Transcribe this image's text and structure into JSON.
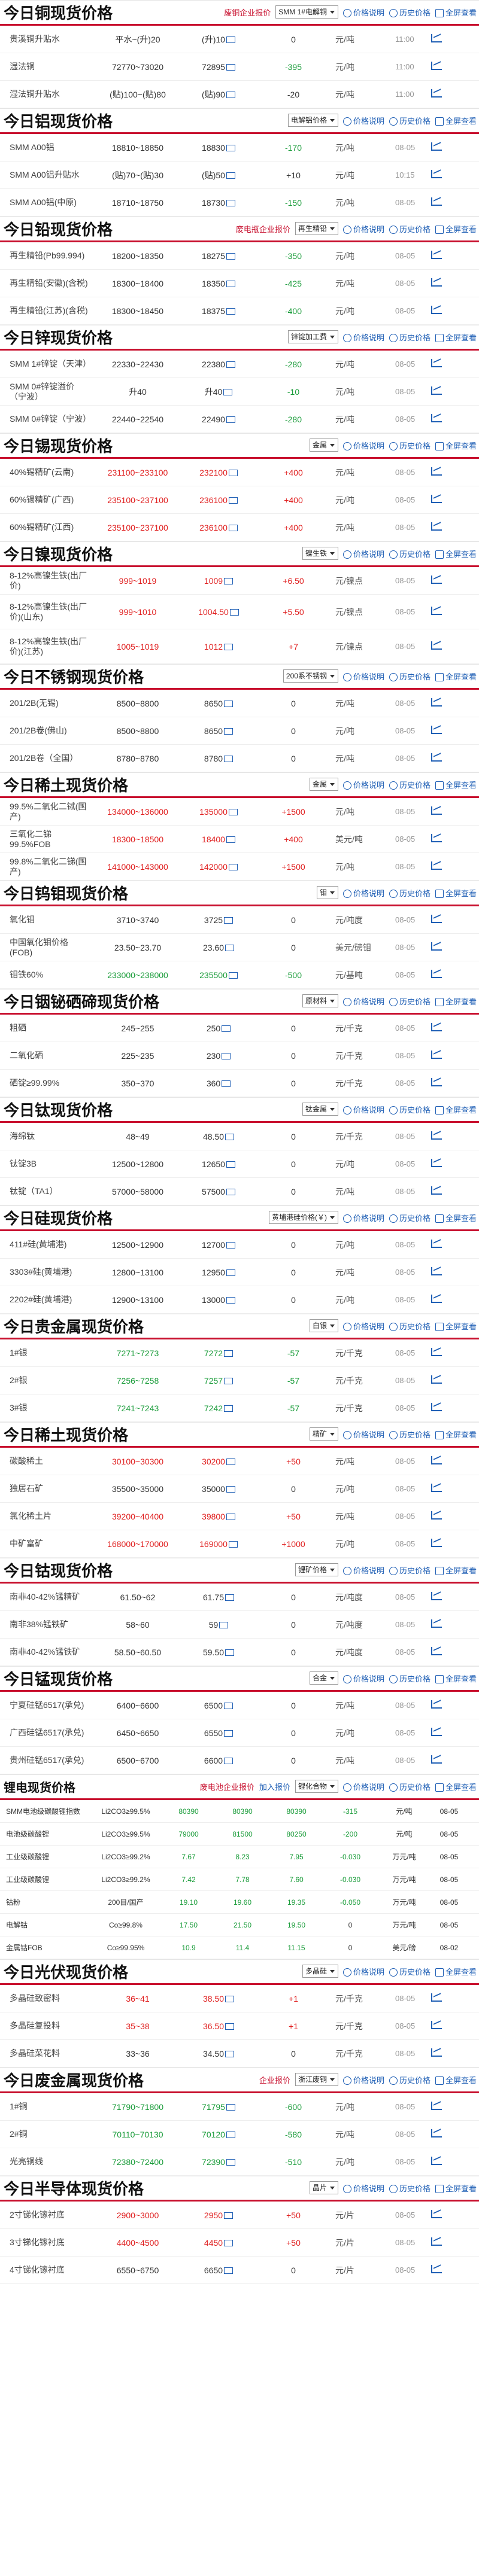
{
  "labels": {
    "join_price": "加入报价",
    "price_desc": "价格说明",
    "history": "历史价格",
    "all": "全屏查看"
  },
  "sections": [
    {
      "title": "今日铜现货价格",
      "tag": "废铜企业报价",
      "select": "SMM 1#电解铜",
      "rows": [
        {
          "name": "贵溪铜升贴水",
          "range": "平水~(升)20",
          "avg": "(升)10",
          "chg": "0",
          "unit": "元/吨",
          "date": "11:00",
          "chg_color": "black"
        },
        {
          "name": "湿法铜",
          "range": "72770~73020",
          "avg": "72895",
          "chg": "-395",
          "unit": "元/吨",
          "date": "11:00",
          "chg_color": "green"
        },
        {
          "name": "湿法铜升贴水",
          "range": "(贴)100~(贴)80",
          "avg": "(贴)90",
          "chg": "-20",
          "unit": "元/吨",
          "date": "11:00",
          "chg_color": "black"
        }
      ]
    },
    {
      "title": "今日铝现货价格",
      "select": "电解铝价格",
      "rows": [
        {
          "name": "SMM A00铝",
          "range": "18810~18850",
          "avg": "18830",
          "chg": "-170",
          "unit": "元/吨",
          "date": "08-05",
          "chg_color": "green"
        },
        {
          "name": "SMM A00铝升贴水",
          "range": "(贴)70~(贴)30",
          "avg": "(贴)50",
          "chg": "+10",
          "unit": "元/吨",
          "date": "10:15",
          "chg_color": "black"
        },
        {
          "name": "SMM A00铝(中原)",
          "range": "18710~18750",
          "avg": "18730",
          "chg": "-150",
          "unit": "元/吨",
          "date": "08-05",
          "chg_color": "green"
        }
      ]
    },
    {
      "title": "今日铅现货价格",
      "tag": "废电瓶企业报价",
      "select": "再生精铅",
      "rows": [
        {
          "name": "再生精铅(Pb99.994)",
          "range": "18200~18350",
          "avg": "18275",
          "chg": "-350",
          "unit": "元/吨",
          "date": "08-05",
          "chg_color": "green"
        },
        {
          "name": "再生精铅(安徽)(含税)",
          "range": "18300~18400",
          "avg": "18350",
          "chg": "-425",
          "unit": "元/吨",
          "date": "08-05",
          "chg_color": "green"
        },
        {
          "name": "再生精铅(江苏)(含税)",
          "range": "18300~18450",
          "avg": "18375",
          "chg": "-400",
          "unit": "元/吨",
          "date": "08-05",
          "chg_color": "green"
        }
      ]
    },
    {
      "title": "今日锌现货价格",
      "select": "锌锭加工费",
      "rows": [
        {
          "name": "SMM 1#锌锭（天津）",
          "range": "22330~22430",
          "avg": "22380",
          "chg": "-280",
          "unit": "元/吨",
          "date": "08-05",
          "chg_color": "green"
        },
        {
          "name": "SMM 0#锌锭溢价（宁波）",
          "range": "升40",
          "avg": "升40",
          "chg": "-10",
          "unit": "元/吨",
          "date": "08-05",
          "chg_color": "green"
        },
        {
          "name": "SMM 0#锌锭（宁波）",
          "range": "22440~22540",
          "avg": "22490",
          "chg": "-280",
          "unit": "元/吨",
          "date": "08-05",
          "chg_color": "green"
        }
      ]
    },
    {
      "title": "今日锡现货价格",
      "select": "金属",
      "rows": [
        {
          "name": "40%锡精矿(云南)",
          "range": "231100~233100",
          "avg": "232100",
          "chg": "+400",
          "unit": "元/吨",
          "date": "08-05",
          "chg_color": "red",
          "rc": "red"
        },
        {
          "name": "60%锡精矿(广西)",
          "range": "235100~237100",
          "avg": "236100",
          "chg": "+400",
          "unit": "元/吨",
          "date": "08-05",
          "chg_color": "red",
          "rc": "red"
        },
        {
          "name": "60%锡精矿(江西)",
          "range": "235100~237100",
          "avg": "236100",
          "chg": "+400",
          "unit": "元/吨",
          "date": "08-05",
          "chg_color": "red",
          "rc": "red"
        }
      ]
    },
    {
      "title": "今日镍现货价格",
      "select": "镍生铁",
      "rows": [
        {
          "name": "8-12%高镍生铁(出厂价)",
          "range": "999~1019",
          "avg": "1009",
          "chg": "+6.50",
          "unit": "元/镍点",
          "date": "08-05",
          "chg_color": "red",
          "rc": "red"
        },
        {
          "name": "8-12%高镍生铁(出厂价)(山东)",
          "range": "999~1010",
          "avg": "1004.50",
          "chg": "+5.50",
          "unit": "元/镍点",
          "date": "08-05",
          "chg_color": "red",
          "rc": "red"
        },
        {
          "name": "8-12%高镍生铁(出厂价)(江苏)",
          "range": "1005~1019",
          "avg": "1012",
          "chg": "+7",
          "unit": "元/镍点",
          "date": "08-05",
          "chg_color": "red",
          "rc": "red"
        }
      ]
    },
    {
      "title": "今日不锈钢现货价格",
      "select": "200系不锈钢",
      "rows": [
        {
          "name": "201/2B(无锡)",
          "range": "8500~8800",
          "avg": "8650",
          "chg": "0",
          "unit": "元/吨",
          "date": "08-05",
          "chg_color": "black"
        },
        {
          "name": "201/2B卷(佛山)",
          "range": "8500~8800",
          "avg": "8650",
          "chg": "0",
          "unit": "元/吨",
          "date": "08-05",
          "chg_color": "black"
        },
        {
          "name": "201/2B卷（全国）",
          "range": "8780~8780",
          "avg": "8780",
          "chg": "0",
          "unit": "元/吨",
          "date": "08-05",
          "chg_color": "black"
        }
      ]
    },
    {
      "title": "今日稀土现货价格",
      "select": "金属",
      "rows": [
        {
          "name": "99.5%二氧化二铽(国产)",
          "range": "134000~136000",
          "avg": "135000",
          "chg": "+1500",
          "unit": "元/吨",
          "date": "08-05",
          "chg_color": "red",
          "rc": "red"
        },
        {
          "name": "三氧化二锑99.5%FOB",
          "range": "18300~18500",
          "avg": "18400",
          "chg": "+400",
          "unit": "美元/吨",
          "date": "08-05",
          "chg_color": "red",
          "rc": "red"
        },
        {
          "name": "99.8%二氧化二锑(国产)",
          "range": "141000~143000",
          "avg": "142000",
          "chg": "+1500",
          "unit": "元/吨",
          "date": "08-05",
          "chg_color": "red",
          "rc": "red"
        }
      ]
    },
    {
      "title": "今日钨钼现货价格",
      "select": "钼",
      "rows": [
        {
          "name": "氧化钼",
          "range": "3710~3740",
          "avg": "3725",
          "chg": "0",
          "unit": "元/吨度",
          "date": "08-05",
          "chg_color": "black"
        },
        {
          "name": "中国氧化钼价格(FOB)",
          "range": "23.50~23.70",
          "avg": "23.60",
          "chg": "0",
          "unit": "美元/磅钼",
          "date": "08-05",
          "chg_color": "black"
        },
        {
          "name": "钼铁60%",
          "range": "233000~238000",
          "avg": "235500",
          "chg": "-500",
          "unit": "元/基吨",
          "date": "08-05",
          "chg_color": "green",
          "rc": "green"
        }
      ]
    },
    {
      "title": "今日铟铋硒碲现货价格",
      "select": "原材料",
      "rows": [
        {
          "name": "粗硒",
          "range": "245~255",
          "avg": "250",
          "chg": "0",
          "unit": "元/千克",
          "date": "08-05",
          "chg_color": "black"
        },
        {
          "name": "二氧化硒",
          "range": "225~235",
          "avg": "230",
          "chg": "0",
          "unit": "元/千克",
          "date": "08-05",
          "chg_color": "black"
        },
        {
          "name": "硒锭≥99.99%",
          "range": "350~370",
          "avg": "360",
          "chg": "0",
          "unit": "元/千克",
          "date": "08-05",
          "chg_color": "black"
        }
      ]
    },
    {
      "title": "今日钛现货价格",
      "select": "钛金属",
      "rows": [
        {
          "name": "海绵钛",
          "range": "48~49",
          "avg": "48.50",
          "chg": "0",
          "unit": "元/千克",
          "date": "08-05",
          "chg_color": "black"
        },
        {
          "name": "钛锭3B",
          "range": "12500~12800",
          "avg": "12650",
          "chg": "0",
          "unit": "元/吨",
          "date": "08-05",
          "chg_color": "black"
        },
        {
          "name": "钛锭（TA1）",
          "range": "57000~58000",
          "avg": "57500",
          "chg": "0",
          "unit": "元/吨",
          "date": "08-05",
          "chg_color": "black"
        }
      ]
    },
    {
      "title": "今日硅现货价格",
      "select": "黄埔港硅价格(￥)",
      "rows": [
        {
          "name": "411#硅(黄埔港)",
          "range": "12500~12900",
          "avg": "12700",
          "chg": "0",
          "unit": "元/吨",
          "date": "08-05",
          "chg_color": "black"
        },
        {
          "name": "3303#硅(黄埔港)",
          "range": "12800~13100",
          "avg": "12950",
          "chg": "0",
          "unit": "元/吨",
          "date": "08-05",
          "chg_color": "black"
        },
        {
          "name": "2202#硅(黄埔港)",
          "range": "12900~13100",
          "avg": "13000",
          "chg": "0",
          "unit": "元/吨",
          "date": "08-05",
          "chg_color": "black"
        }
      ]
    },
    {
      "title": "今日贵金属现货价格",
      "select": "白银",
      "rows": [
        {
          "name": "1#银",
          "range": "7271~7273",
          "avg": "7272",
          "chg": "-57",
          "unit": "元/千克",
          "date": "08-05",
          "chg_color": "green",
          "rc": "green"
        },
        {
          "name": "2#银",
          "range": "7256~7258",
          "avg": "7257",
          "chg": "-57",
          "unit": "元/千克",
          "date": "08-05",
          "chg_color": "green",
          "rc": "green"
        },
        {
          "name": "3#银",
          "range": "7241~7243",
          "avg": "7242",
          "chg": "-57",
          "unit": "元/千克",
          "date": "08-05",
          "chg_color": "green",
          "rc": "green"
        }
      ]
    },
    {
      "title": "今日稀土现货价格",
      "select": "精矿",
      "rows": [
        {
          "name": "碳酸稀土",
          "range": "30100~30300",
          "avg": "30200",
          "chg": "+50",
          "unit": "元/吨",
          "date": "08-05",
          "chg_color": "red",
          "rc": "red"
        },
        {
          "name": "独居石矿",
          "range": "35500~35000",
          "avg": "35000",
          "chg": "0",
          "unit": "元/吨",
          "date": "08-05",
          "chg_color": "black"
        },
        {
          "name": "氯化稀土片",
          "range": "39200~40400",
          "avg": "39800",
          "chg": "+50",
          "unit": "元/吨",
          "date": "08-05",
          "chg_color": "red",
          "rc": "red"
        },
        {
          "name": "中矿富矿",
          "range": "168000~170000",
          "avg": "169000",
          "chg": "+1000",
          "unit": "元/吨",
          "date": "08-05",
          "chg_color": "red",
          "rc": "red"
        }
      ]
    },
    {
      "title": "今日钴现货价格",
      "select": "锂矿价格",
      "rows": [
        {
          "name": "南非40-42%锰精矿",
          "range": "61.50~62",
          "avg": "61.75",
          "chg": "0",
          "unit": "元/吨度",
          "date": "08-05",
          "chg_color": "black"
        },
        {
          "name": "南非38%锰铁矿",
          "range": "58~60",
          "avg": "59",
          "chg": "0",
          "unit": "元/吨度",
          "date": "08-05",
          "chg_color": "black"
        },
        {
          "name": "南非40-42%锰铁矿",
          "range": "58.50~60.50",
          "avg": "59.50",
          "chg": "0",
          "unit": "元/吨度",
          "date": "08-05",
          "chg_color": "black"
        }
      ]
    },
    {
      "title": "今日锰现货价格",
      "select": "合金",
      "rows": [
        {
          "name": "宁夏硅锰6517(承兑)",
          "range": "6400~6600",
          "avg": "6500",
          "chg": "0",
          "unit": "元/吨",
          "date": "08-05",
          "chg_color": "black"
        },
        {
          "name": "广西硅锰6517(承兑)",
          "range": "6450~6650",
          "avg": "6550",
          "chg": "0",
          "unit": "元/吨",
          "date": "08-05",
          "chg_color": "black"
        },
        {
          "name": "贵州硅锰6517(承兑)",
          "range": "6500~6700",
          "avg": "6600",
          "chg": "0",
          "unit": "元/吨",
          "date": "08-05",
          "chg_color": "black"
        }
      ]
    }
  ],
  "lithium": {
    "title": "锂电现货价格",
    "tag": "废电池企业报价",
    "select": "锂化合物",
    "headers": [
      "",
      "产品",
      "低价",
      "高价",
      "均价",
      "涨跌",
      "单位",
      "日期"
    ],
    "rows": [
      [
        "SMM电池级碳酸锂指数",
        "Li2CO3≥99.5%",
        "80390",
        "80390",
        "80390",
        "-315",
        "元/吨",
        "08-05"
      ],
      [
        "电池级碳酸锂",
        "Li2CO3≥99.5%",
        "79000",
        "81500",
        "80250",
        "-200",
        "元/吨",
        "08-05"
      ],
      [
        "工业级碳酸锂",
        "Li2CO3≥99.2%",
        "7.67",
        "8.23",
        "7.95",
        "-0.030",
        "万元/吨",
        "08-05"
      ],
      [
        "工业级碳酸锂",
        "Li2CO3≥99.2%",
        "7.42",
        "7.78",
        "7.60",
        "-0.030",
        "万元/吨",
        "08-05"
      ],
      [
        "钴粉",
        "200目/国产",
        "19.10",
        "19.60",
        "19.35",
        "-0.050",
        "万元/吨",
        "08-05"
      ],
      [
        "电解钴",
        "Co≥99.8%",
        "17.50",
        "21.50",
        "19.50",
        "0",
        "万元/吨",
        "08-05"
      ],
      [
        "金属钴FOB",
        "Co≥99.95%",
        "10.9",
        "11.4",
        "11.15",
        "0",
        "美元/磅",
        "08-02"
      ]
    ]
  },
  "tail_sections": [
    {
      "title": "今日光伏现货价格",
      "select": "多晶硅",
      "rows": [
        {
          "name": "多晶硅致密料",
          "range": "36~41",
          "avg": "38.50",
          "chg": "+1",
          "unit": "元/千克",
          "date": "08-05",
          "chg_color": "red",
          "rc": "red"
        },
        {
          "name": "多晶硅复投料",
          "range": "35~38",
          "avg": "36.50",
          "chg": "+1",
          "unit": "元/千克",
          "date": "08-05",
          "chg_color": "red",
          "rc": "red"
        },
        {
          "name": "多晶硅菜花料",
          "range": "33~36",
          "avg": "34.50",
          "chg": "0",
          "unit": "元/千克",
          "date": "08-05",
          "chg_color": "black"
        }
      ]
    },
    {
      "title": "今日废金属现货价格",
      "tag": "企业报价",
      "select": "浙江废铜",
      "rows": [
        {
          "name": "1#铜",
          "range": "71790~71800",
          "avg": "71795",
          "chg": "-600",
          "unit": "元/吨",
          "date": "08-05",
          "chg_color": "green",
          "rc": "green"
        },
        {
          "name": "2#铜",
          "range": "70110~70130",
          "avg": "70120",
          "chg": "-580",
          "unit": "元/吨",
          "date": "08-05",
          "chg_color": "green",
          "rc": "green"
        },
        {
          "name": "光亮铜线",
          "range": "72380~72400",
          "avg": "72390",
          "chg": "-510",
          "unit": "元/吨",
          "date": "08-05",
          "chg_color": "green",
          "rc": "green"
        }
      ]
    },
    {
      "title": "今日半导体现货价格",
      "select": "晶片",
      "rows": [
        {
          "name": "2寸锑化镓衬底",
          "range": "2900~3000",
          "avg": "2950",
          "chg": "+50",
          "unit": "元/片",
          "date": "08-05",
          "chg_color": "red",
          "rc": "red"
        },
        {
          "name": "3寸锑化镓衬底",
          "range": "4400~4500",
          "avg": "4450",
          "chg": "+50",
          "unit": "元/片",
          "date": "08-05",
          "chg_color": "red",
          "rc": "red"
        },
        {
          "name": "4寸锑化镓衬底",
          "range": "6550~6750",
          "avg": "6650",
          "chg": "0",
          "unit": "元/片",
          "date": "08-05",
          "chg_color": "black"
        }
      ]
    }
  ]
}
